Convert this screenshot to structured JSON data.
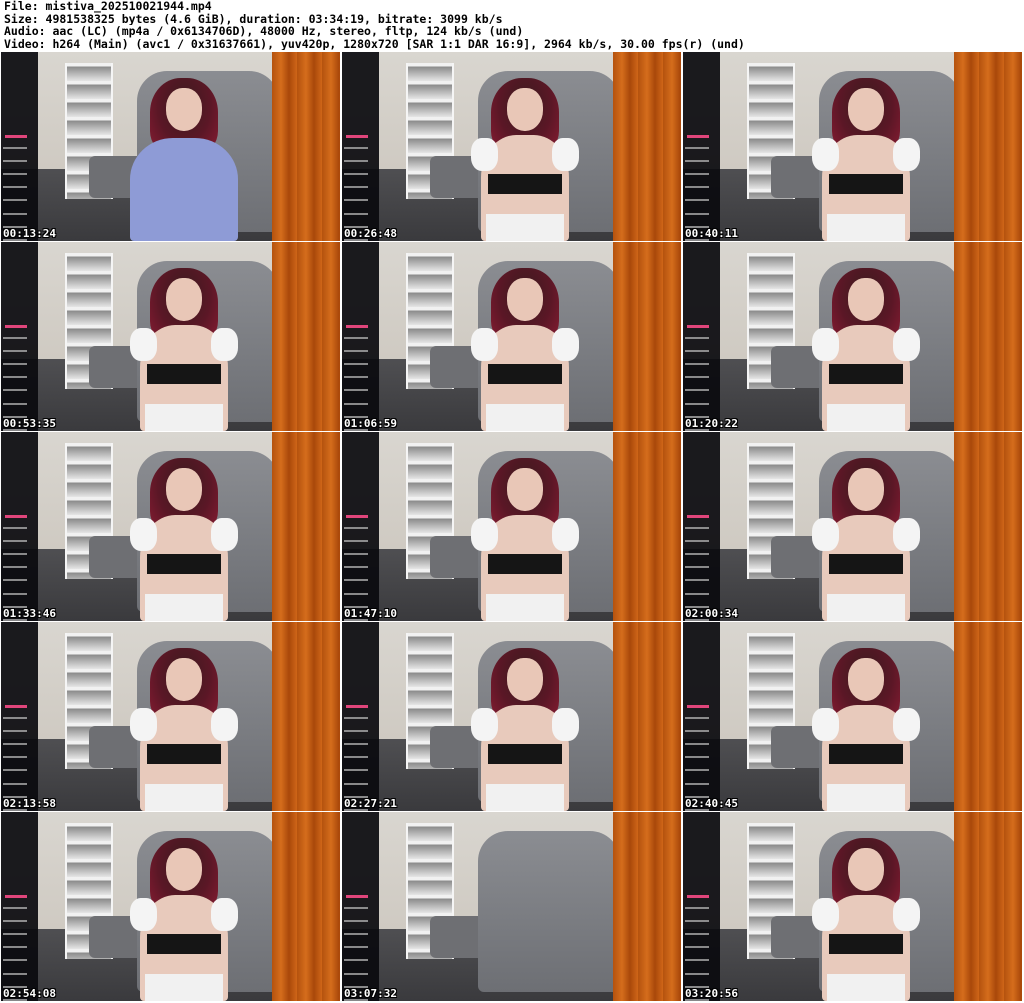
{
  "header": {
    "line1": "File: mistiva_202510021944.mp4",
    "line2": "Size: 4981538325 bytes (4.6 GiB), duration: 03:34:19, bitrate: 3099 kb/s",
    "line3": "Audio: aac (LC) (mp4a / 0x6134706D), 48000 Hz, stereo, fltp, 124 kb/s (und)",
    "line4": "Video: h264 (Main) (avc1 / 0x31637661), yuv420p, 1280x720 [SAR 1:1 DAR 16:9], 2964 kb/s, 30.00 fps(r) (und)"
  },
  "colors": {
    "curtain": "#c85f16",
    "overlay": "#0a0a0e",
    "hair": "#8a1c33",
    "top": "#151515",
    "ruffle": "#f4f4f4",
    "tee": "#8e9bd6"
  },
  "thumbnails": [
    {
      "time": "00:13:24",
      "outfit": "tee"
    },
    {
      "time": "00:26:48",
      "outfit": "ruffle"
    },
    {
      "time": "00:40:11",
      "outfit": "ruffle"
    },
    {
      "time": "00:53:35",
      "outfit": "ruffle"
    },
    {
      "time": "01:06:59",
      "outfit": "ruffle"
    },
    {
      "time": "01:20:22",
      "outfit": "ruffle"
    },
    {
      "time": "01:33:46",
      "outfit": "ruffle"
    },
    {
      "time": "01:47:10",
      "outfit": "ruffle"
    },
    {
      "time": "02:00:34",
      "outfit": "ruffle"
    },
    {
      "time": "02:13:58",
      "outfit": "ruffle"
    },
    {
      "time": "02:27:21",
      "outfit": "ruffle"
    },
    {
      "time": "02:40:45",
      "outfit": "ruffle"
    },
    {
      "time": "02:54:08",
      "outfit": "ruffle"
    },
    {
      "time": "03:07:32",
      "outfit": "none"
    },
    {
      "time": "03:20:56",
      "outfit": "ruffle"
    }
  ]
}
